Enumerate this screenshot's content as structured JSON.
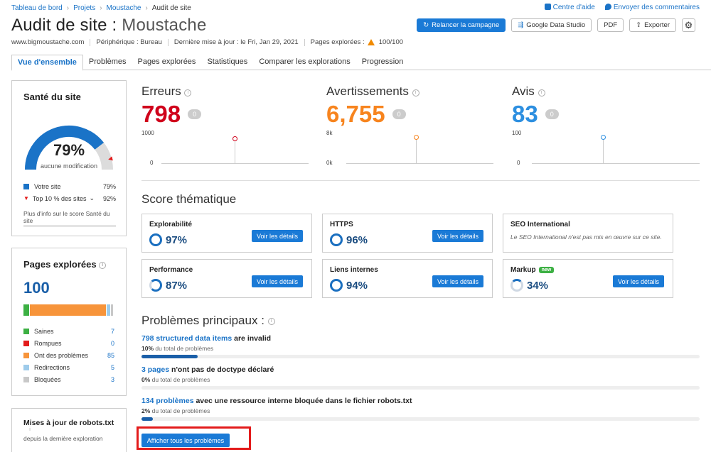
{
  "breadcrumb": [
    "Tableau de bord",
    "Projets",
    "Moustache",
    "Audit de site"
  ],
  "top_links": {
    "help": "Centre d'aide",
    "feedback": "Envoyer des commentaires"
  },
  "title": {
    "main": "Audit de site : ",
    "project": "Moustache"
  },
  "meta": {
    "domain": "www.bigmoustache.com",
    "device": "Périphérique : Bureau",
    "updated": "Dernière mise à jour : le Fri, Jan 29, 2021",
    "crawled_label": "Pages explorées :",
    "crawled_value": "100/100"
  },
  "actions": {
    "relaunch": "Relancer la campagne",
    "gds": "Google Data Studio",
    "pdf": "PDF",
    "export": "Exporter"
  },
  "tabs": [
    "Vue d'ensemble",
    "Problèmes",
    "Pages explorées",
    "Statistiques",
    "Comparer les explorations",
    "Progression"
  ],
  "health": {
    "title": "Santé du site",
    "percent": "79%",
    "percent_value": 0.79,
    "top10_value": 0.92,
    "change": "aucune modification",
    "legend": [
      {
        "label": "Votre site",
        "value": "79%",
        "color": "#1a73c7"
      },
      {
        "label": "Top 10 % des sites",
        "value": "92%",
        "color": "#e31b1b"
      }
    ],
    "more": "Plus d'info sur le score Santé du site"
  },
  "crawled": {
    "title": "Pages explorées",
    "total": "100",
    "segments": [
      {
        "label": "Saines",
        "value": "7",
        "color": "#3cb043"
      },
      {
        "label": "Rompues",
        "value": "0",
        "color": "#e31b1b"
      },
      {
        "label": "Ont des problèmes",
        "value": "85",
        "color": "#f7943a"
      },
      {
        "label": "Redirections",
        "value": "5",
        "color": "#9ecbea"
      },
      {
        "label": "Bloquées",
        "value": "3",
        "color": "#c8c8c8"
      }
    ]
  },
  "robots": {
    "title": "Mises à jour de robots.txt",
    "sub": "depuis la dernière exploration"
  },
  "metrics": [
    {
      "label": "Erreurs",
      "value": "798",
      "delta": "0",
      "color": "#d0021b",
      "ymax": "1000",
      "ymin": "0"
    },
    {
      "label": "Avertissements",
      "value": "6,755",
      "delta": "0",
      "color": "#f7841e",
      "ymax": "8k",
      "ymin": "0k"
    },
    {
      "label": "Avis",
      "value": "83",
      "delta": "0",
      "color": "#2d8fe0",
      "ymax": "100",
      "ymin": "0"
    }
  ],
  "thematic": {
    "title": "Score thématique",
    "view_label": "Voir les détails",
    "cards": [
      {
        "name": "Explorabilité",
        "score": "97%"
      },
      {
        "name": "HTTPS",
        "score": "96%"
      },
      {
        "name": "SEO International",
        "note": "Le SEO International n'est pas mis en œuvre sur ce site."
      },
      {
        "name": "Performance",
        "score": "87%"
      },
      {
        "name": "Liens internes",
        "score": "94%"
      },
      {
        "name": "Markup",
        "score": "34%",
        "badge": "new"
      }
    ]
  },
  "issues": {
    "title": "Problèmes principaux :",
    "items": [
      {
        "link": "798 structured data items",
        "text": " are invalid",
        "pct": "10%",
        "sub": " du total de problèmes",
        "fraction": 0.1
      },
      {
        "link": "3 pages",
        "text": " n'ont pas de doctype déclaré",
        "pct": "0%",
        "sub": " du total de problèmes",
        "fraction": 0.0
      },
      {
        "link": "134 problèmes",
        "text": " avec une ressource interne bloquée dans le fichier robots.txt",
        "pct": "2%",
        "sub": " du total de problèmes",
        "fraction": 0.02
      }
    ],
    "show_all": "Afficher tous les problèmes"
  }
}
